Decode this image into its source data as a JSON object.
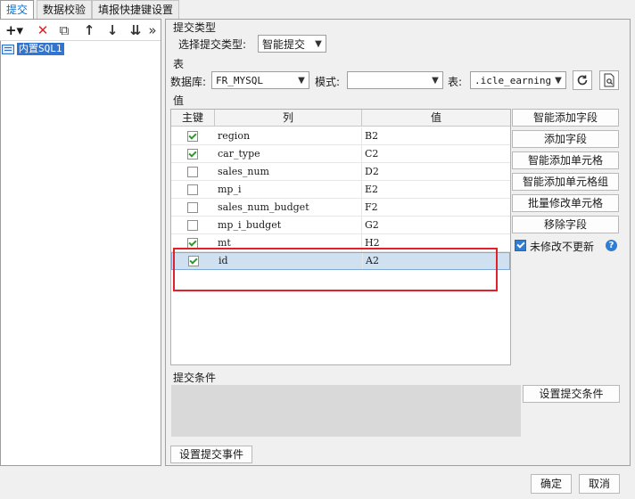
{
  "tabs": [
    {
      "label": "提交",
      "active": true
    },
    {
      "label": "数据校验",
      "active": false
    },
    {
      "label": "填报快捷键设置",
      "active": false
    }
  ],
  "left": {
    "toolbar": {
      "add": "+▾",
      "delete": "✕",
      "copy": "⧉",
      "up": "↑",
      "down": "↓",
      "move_bottom": "⇊",
      "more": "»"
    },
    "tree_item": "内置SQL1"
  },
  "submit_type": {
    "section_label": "提交类型",
    "select_label": "选择提交类型:",
    "value": "智能提交"
  },
  "table_section": {
    "label": "表",
    "db_label": "数据库:",
    "db_value": "FR_MYSQL",
    "schema_label": "模式:",
    "schema_value": "",
    "table_label": "表:",
    "table_value": ".icle_earnings"
  },
  "values": {
    "label": "值",
    "headers": [
      "主键",
      "列",
      "值"
    ],
    "rows": [
      {
        "key": true,
        "column": "region",
        "value": "B2",
        "selected": false
      },
      {
        "key": true,
        "column": "car_type",
        "value": "C2",
        "selected": false
      },
      {
        "key": false,
        "column": "sales_num",
        "value": "D2",
        "selected": false
      },
      {
        "key": false,
        "column": "mp_i",
        "value": "E2",
        "selected": false
      },
      {
        "key": false,
        "column": "sales_num_budget",
        "value": "F2",
        "selected": false
      },
      {
        "key": false,
        "column": "mp_i_budget",
        "value": "G2",
        "selected": false
      },
      {
        "key": true,
        "column": "mt",
        "value": "H2",
        "selected": false
      },
      {
        "key": true,
        "column": "id",
        "value": "A2",
        "selected": true
      }
    ]
  },
  "side_buttons": {
    "smart_add_field": "智能添加字段",
    "add_field": "添加字段",
    "smart_add_cell": "智能添加单元格",
    "smart_add_cell_group": "智能添加单元格组",
    "batch_modify_cell": "批量修改单元格",
    "remove_field": "移除字段",
    "no_update_unmodified": "未修改不更新",
    "help": "?"
  },
  "condition": {
    "label": "提交条件",
    "set_button": "设置提交条件"
  },
  "event_button": "设置提交事件",
  "footer": {
    "ok": "确定",
    "cancel": "取消"
  },
  "colors": {
    "accent": "#2f7dd3",
    "highlight": "#e0202a",
    "selection": "#cfe0f1"
  }
}
